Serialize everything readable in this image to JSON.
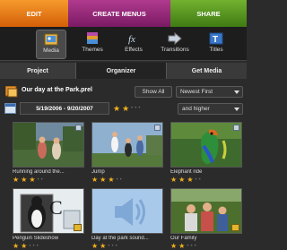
{
  "tabs": {
    "edit": "EDIT",
    "create": "CREATE MENUS",
    "share": "SHARE"
  },
  "toolbar": {
    "media": "Media",
    "themes": "Themes",
    "effects": "Effects",
    "transitions": "Transitions",
    "titles": "Titles"
  },
  "subtabs": {
    "project": "Project",
    "organizer": "Organizer",
    "get_media": "Get Media"
  },
  "catalog": {
    "title": "Our day at the Park.prel",
    "show_all": "Show All",
    "sort": "Newest First"
  },
  "filter": {
    "date_range": "5/19/2006 - 9/20/2007",
    "rating": 2,
    "max_rating": 5,
    "qualifier": "and higher"
  },
  "media_items": [
    {
      "caption": "Running around the...",
      "rating": 3
    },
    {
      "caption": "Jump",
      "rating": 3
    },
    {
      "caption": "Elephant ride",
      "rating": 3
    },
    {
      "caption": "Penguin Slideshow",
      "rating": 2
    },
    {
      "caption": "Day at the park sound...",
      "rating": 2
    },
    {
      "caption": "Our Family",
      "rating": 2
    }
  ],
  "colors": {
    "edit_tab": "#e8801a",
    "create_tab": "#9b2d7b",
    "share_tab": "#5b9a22",
    "star_on": "#f2b01e"
  },
  "icons": [
    "media-icon",
    "themes-icon",
    "effects-icon",
    "transitions-icon",
    "titles-icon",
    "catalog-icon",
    "calendar-icon"
  ]
}
